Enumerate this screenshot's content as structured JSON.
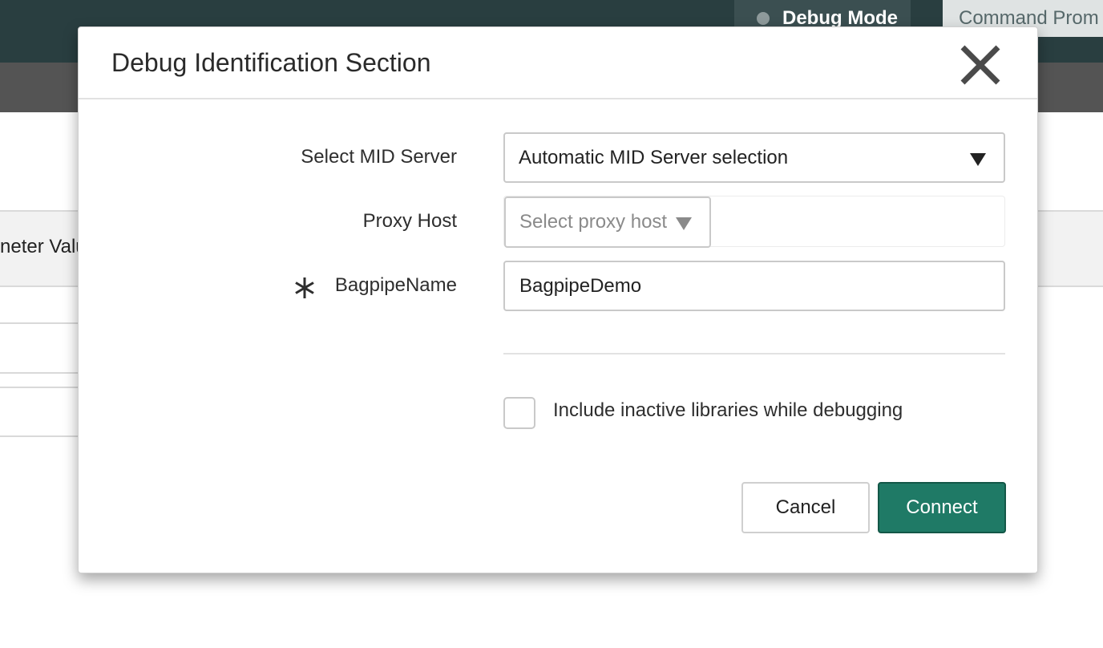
{
  "app": {
    "tabs": {
      "debug_mode": "Debug Mode",
      "command_prompt": "Command Prom"
    },
    "background_text": "neter Valu"
  },
  "dialog": {
    "title": "Debug Identification Section",
    "fields": {
      "mid_server": {
        "label": "Select MID Server",
        "value": "Automatic MID Server selection"
      },
      "proxy_host": {
        "label": "Proxy Host",
        "placeholder": "Select proxy host"
      },
      "bagpipe_name": {
        "label": "BagpipeName",
        "value": "BagpipeDemo",
        "required": true
      }
    },
    "checkbox": {
      "label": "Include inactive libraries while debugging",
      "checked": false
    },
    "buttons": {
      "cancel": "Cancel",
      "connect": "Connect"
    }
  },
  "colors": {
    "header_bg": "#293e40",
    "primary_button": "#1f7a66"
  },
  "icons": {
    "close": "close-icon",
    "dropdown": "triangle-down-icon",
    "required": "asterisk-icon",
    "status": "status-dot-icon"
  }
}
